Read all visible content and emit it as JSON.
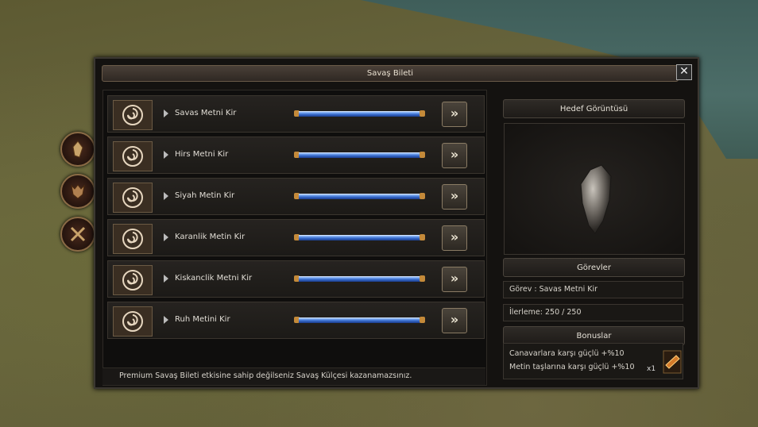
{
  "window": {
    "title": "Savaş Bileti",
    "close_glyph": "✕"
  },
  "side_buttons": [
    {
      "icon": "crystal-icon"
    },
    {
      "icon": "demon-icon"
    },
    {
      "icon": "crossed-swords-icon"
    }
  ],
  "missions": [
    {
      "label": "Savas Metni Kir",
      "progress": 1.0
    },
    {
      "label": "Hirs Metni Kir",
      "progress": 1.0
    },
    {
      "label": "Siyah Metin Kir",
      "progress": 1.0
    },
    {
      "label": "Karanlik Metin Kir",
      "progress": 1.0
    },
    {
      "label": "Kiskanclik Metni Kir",
      "progress": 1.0
    },
    {
      "label": "Ruh Metini Kir",
      "progress": 1.0
    }
  ],
  "go_glyph": "»",
  "notice": "Premium Savaş Bileti etkisine sahip değilseniz Savaş Külçesi kazanamazsınız.",
  "right": {
    "preview_header": "Hedef Görüntüsü",
    "tasks_header": "Görevler",
    "task": "Görev : Savas Metni Kir",
    "progress_text": "İlerleme: 250 / 250",
    "bonus_header": "Bonuslar",
    "bonus_line1": "Canavarlara karşı güçlü +%10",
    "bonus_line2": "Metin taşlarına karşı güçlü +%10",
    "reward_qty": "x1",
    "reward_icon": "war-ingot-icon"
  },
  "colors": {
    "bar_blue": "#3a6fcf",
    "cap": "#c48a3a"
  }
}
